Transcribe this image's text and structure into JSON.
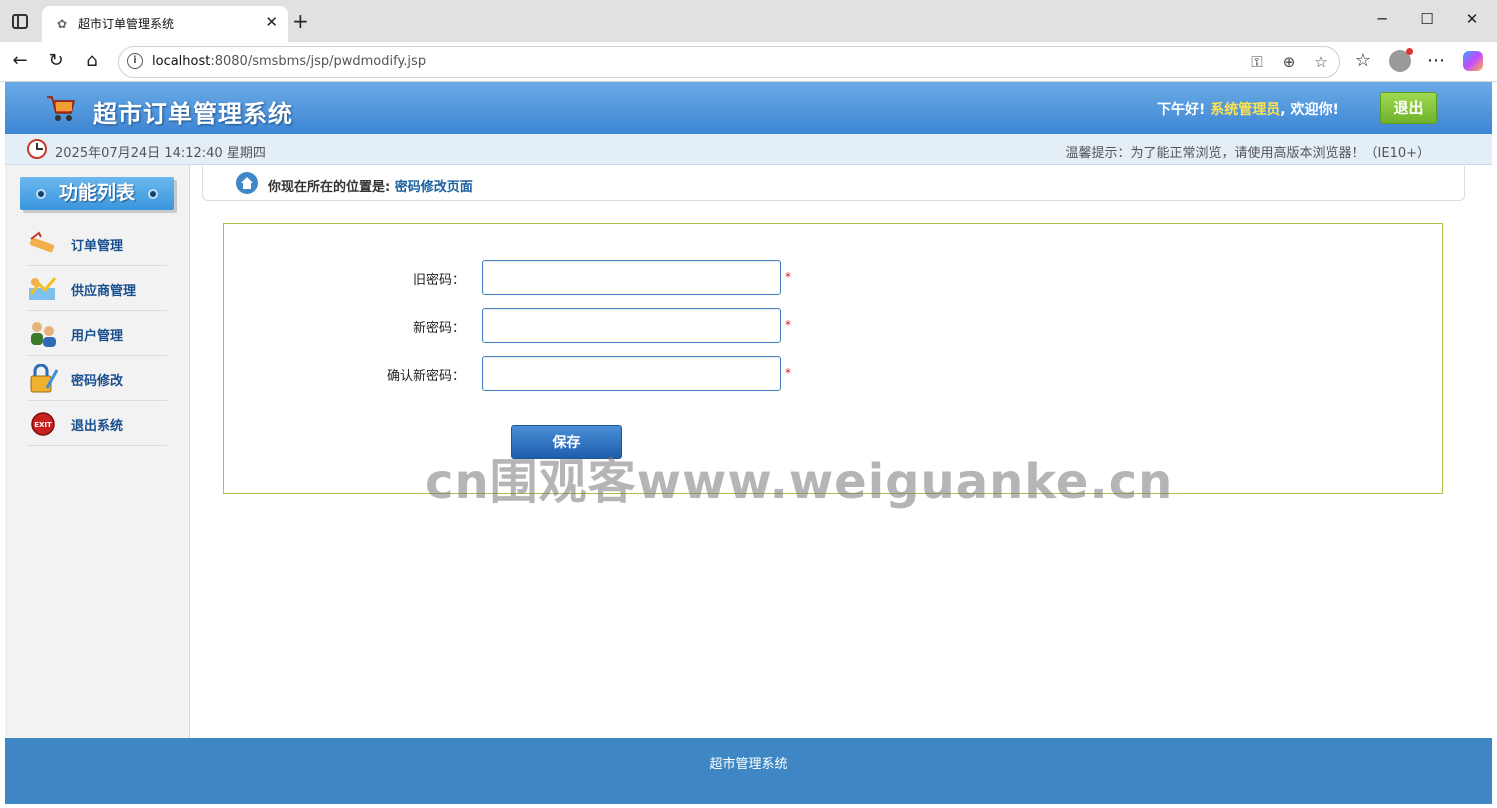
{
  "browser": {
    "tab_title": "超市订单管理系统",
    "tab_close": "✕",
    "new_tab": "+",
    "win_minimize": "─",
    "win_maximize": "☐",
    "win_close": "✕",
    "url_host": "localhost",
    "url_rest": ":8080/smsbms/jsp/pwdmodify.jsp",
    "icons": [
      "tab-actions-icon",
      "back-icon",
      "refresh-icon",
      "home-icon",
      "site-info-icon",
      "key-icon",
      "zoom-icon",
      "favorite-star-icon",
      "favorites-list-icon",
      "profile-icon",
      "more-icon",
      "copilot-icon"
    ]
  },
  "header": {
    "title": "超市订单管理系统",
    "greeting_prefix": "下午好!",
    "username": "系统管理员",
    "greeting_suffix": ", 欢迎你!",
    "logout": "退出"
  },
  "infobar": {
    "datetime": "2025年07月24日 14:12:40 星期四",
    "tip": "温馨提示：为了能正常浏览，请使用高版本浏览器！（IE10+）"
  },
  "sidebar": {
    "title": "功能列表",
    "items": [
      {
        "label": "订单管理",
        "icon": "order-icon"
      },
      {
        "label": "供应商管理",
        "icon": "supplier-icon"
      },
      {
        "label": "用户管理",
        "icon": "users-icon"
      },
      {
        "label": "密码修改",
        "icon": "password-icon"
      },
      {
        "label": "退出系统",
        "icon": "exit-icon"
      }
    ]
  },
  "breadcrumb": {
    "prefix": "你现在所在的位置是:",
    "current": "密码修改页面"
  },
  "form": {
    "old_password_label": "旧密码：",
    "new_password_label": "新密码：",
    "confirm_password_label": "确认新密码：",
    "old_password_value": "",
    "new_password_value": "",
    "confirm_password_value": "",
    "required_mark": "*",
    "save": "保存"
  },
  "watermark": "cn围观客www.weiguanke.cn",
  "footer": {
    "text": "超市管理系统"
  },
  "colors": {
    "header_top": "#6aabe6",
    "header_bottom": "#3d86d4",
    "footer": "#3f86c4",
    "username": "#ffe24d",
    "logout_button": "#7cc235",
    "form_border": "#a6c24a",
    "required": "#e02020"
  }
}
